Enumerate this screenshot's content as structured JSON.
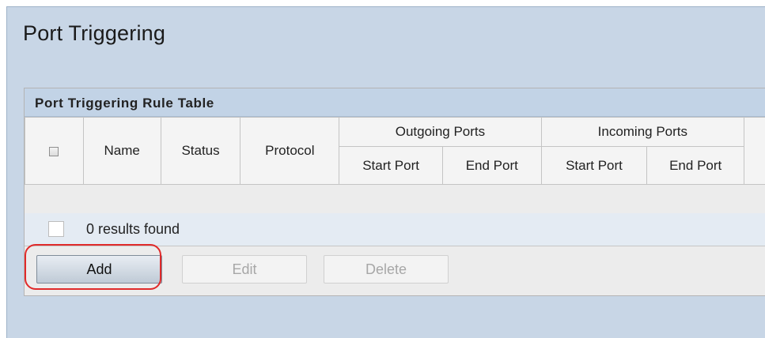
{
  "page": {
    "title": "Port Triggering"
  },
  "table": {
    "title": "Port Triggering Rule Table",
    "headers": {
      "name": "Name",
      "status": "Status",
      "protocol": "Protocol",
      "outgoing_ports": "Outgoing Ports",
      "incoming_ports": "Incoming Ports",
      "start_port": "Start Port",
      "end_port": "End Port"
    },
    "results_text": "0 results found"
  },
  "actions": {
    "add": "Add",
    "edit": "Edit",
    "delete": "Delete"
  },
  "colors": {
    "background": "#c8d6e6",
    "panel_header": "#c2d3e6",
    "highlight": "#e02a2a"
  }
}
